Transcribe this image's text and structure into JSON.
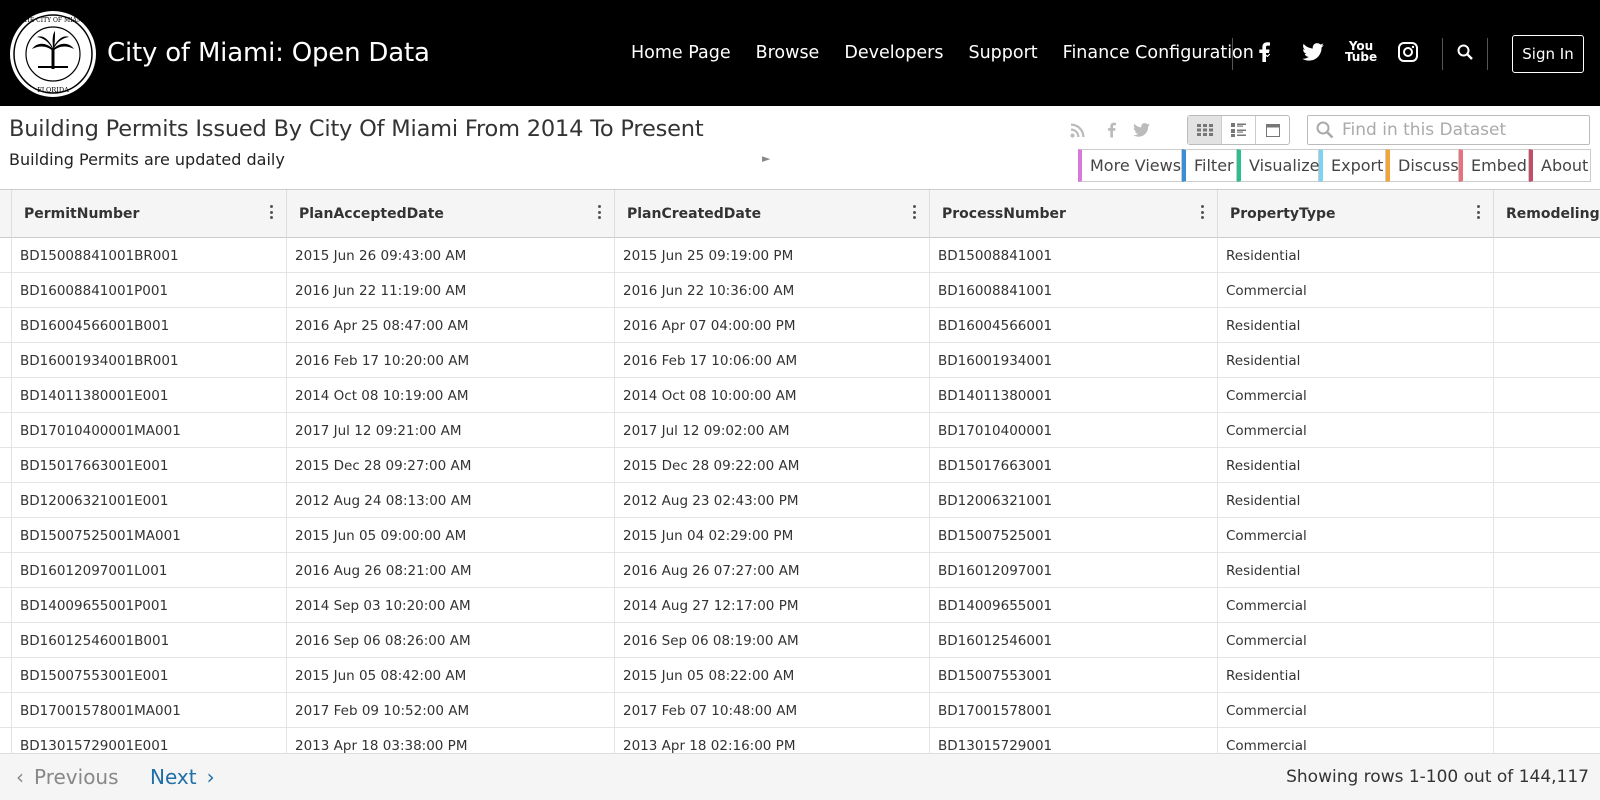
{
  "site": {
    "title": "City of Miami: Open Data",
    "seal_text": "THE CITY OF MIAMI · FLORIDA · INCORPORATED 1896"
  },
  "nav": {
    "items": [
      "Home Page",
      "Browse",
      "Developers",
      "Support",
      "Finance Configuration"
    ],
    "sign_in": "Sign In",
    "social": [
      "facebook-icon",
      "twitter-icon",
      "youtube-icon",
      "instagram-icon"
    ],
    "youtube_text_top": "You",
    "youtube_text_bottom": "Tube"
  },
  "dataset": {
    "title": "Building Permits Issued By City Of Miami From 2014 To Present",
    "subtitle": "Building Permits are updated daily",
    "search_placeholder": "Find in this Dataset",
    "pane_buttons": [
      "More Views",
      "Filter",
      "Visualize",
      "Export",
      "Discuss",
      "Embed",
      "About"
    ],
    "pane_colors": [
      "#d77ad7",
      "#3a8ed6",
      "#2bbf8b",
      "#7fd3f0",
      "#f2a33a",
      "#e8727b",
      "#c44d6a"
    ]
  },
  "table": {
    "columns": [
      "PermitNumber",
      "PlanAcceptedDate",
      "PlanCreatedDate",
      "ProcessNumber",
      "PropertyType",
      "RemodelingCo"
    ],
    "rows": [
      [
        "BD15008841001BR001",
        "2015 Jun 26 09:43:00 AM",
        "2015 Jun 25 09:19:00 PM",
        "BD15008841001",
        "Residential"
      ],
      [
        "BD16008841001P001",
        "2016 Jun 22 11:19:00 AM",
        "2016 Jun 22 10:36:00 AM",
        "BD16008841001",
        "Commercial"
      ],
      [
        "BD16004566001B001",
        "2016 Apr 25 08:47:00 AM",
        "2016 Apr 07 04:00:00 PM",
        "BD16004566001",
        "Residential"
      ],
      [
        "BD16001934001BR001",
        "2016 Feb 17 10:20:00 AM",
        "2016 Feb 17 10:06:00 AM",
        "BD16001934001",
        "Residential"
      ],
      [
        "BD14011380001E001",
        "2014 Oct 08 10:19:00 AM",
        "2014 Oct 08 10:00:00 AM",
        "BD14011380001",
        "Commercial"
      ],
      [
        "BD17010400001MA001",
        "2017 Jul 12 09:21:00 AM",
        "2017 Jul 12 09:02:00 AM",
        "BD17010400001",
        "Commercial"
      ],
      [
        "BD15017663001E001",
        "2015 Dec 28 09:27:00 AM",
        "2015 Dec 28 09:22:00 AM",
        "BD15017663001",
        "Residential"
      ],
      [
        "BD12006321001E001",
        "2012 Aug 24 08:13:00 AM",
        "2012 Aug 23 02:43:00 PM",
        "BD12006321001",
        "Residential"
      ],
      [
        "BD15007525001MA001",
        "2015 Jun 05 09:00:00 AM",
        "2015 Jun 04 02:29:00 PM",
        "BD15007525001",
        "Commercial"
      ],
      [
        "BD16012097001L001",
        "2016 Aug 26 08:21:00 AM",
        "2016 Aug 26 07:27:00 AM",
        "BD16012097001",
        "Residential"
      ],
      [
        "BD14009655001P001",
        "2014 Sep 03 10:20:00 AM",
        "2014 Aug 27 12:17:00 PM",
        "BD14009655001",
        "Commercial"
      ],
      [
        "BD16012546001B001",
        "2016 Sep 06 08:26:00 AM",
        "2016 Sep 06 08:19:00 AM",
        "BD16012546001",
        "Commercial"
      ],
      [
        "BD15007553001E001",
        "2015 Jun 05 08:42:00 AM",
        "2015 Jun 05 08:22:00 AM",
        "BD15007553001",
        "Residential"
      ],
      [
        "BD17001578001MA001",
        "2017 Feb 09 10:52:00 AM",
        "2017 Feb 07 10:48:00 AM",
        "BD17001578001",
        "Commercial"
      ],
      [
        "BD13015729001E001",
        "2013 Apr 18 03:38:00 PM",
        "2013 Apr 18 02:16:00 PM",
        "BD13015729001",
        "Commercial"
      ]
    ]
  },
  "pager": {
    "previous": "Previous",
    "next": "Next",
    "row_info": "Showing rows 1-100 out of 144,117"
  }
}
